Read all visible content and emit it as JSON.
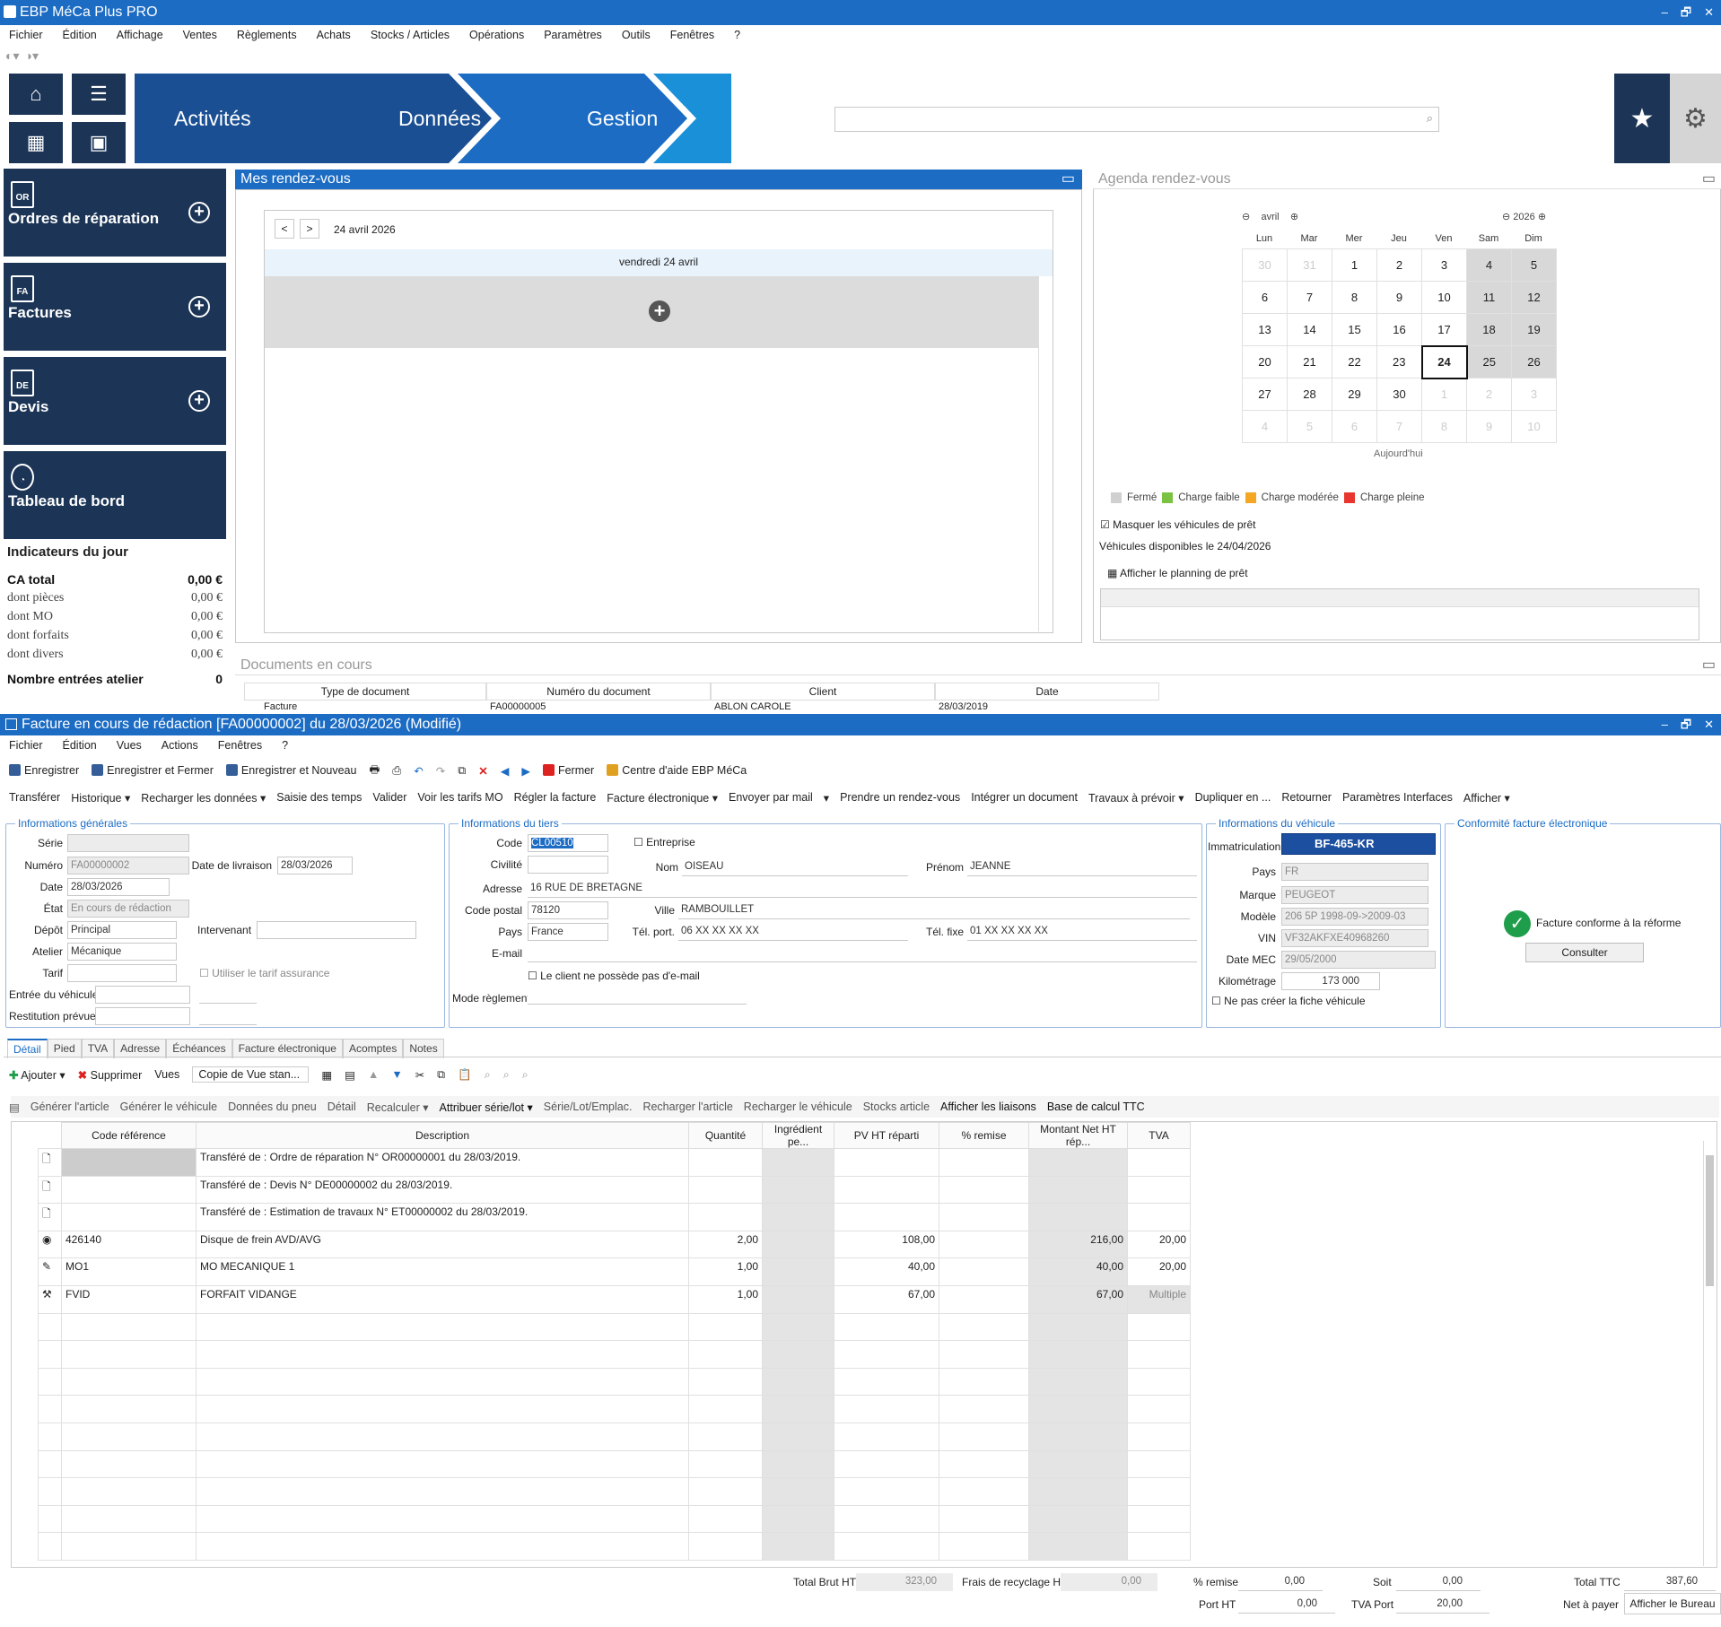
{
  "app": {
    "title": "EBP MéCa Plus PRO",
    "window_controls": [
      "–",
      "🗗",
      "✕"
    ]
  },
  "menu": [
    "Fichier",
    "Édition",
    "Affichage",
    "Ventes",
    "Règlements",
    "Achats",
    "Stocks / Articles",
    "Opérations",
    "Paramètres",
    "Outils",
    "Fenêtres",
    "?"
  ],
  "nav_tabs": [
    "Activités",
    "Données",
    "Gestion"
  ],
  "cards": [
    {
      "abbr": "OR",
      "label": "Ordres de réparation"
    },
    {
      "abbr": "FA",
      "label": "Factures"
    },
    {
      "abbr": "DE",
      "label": "Devis"
    },
    {
      "abbr": "",
      "label": "Tableau de bord"
    }
  ],
  "indicators": {
    "title": "Indicateurs du jour",
    "rows": [
      {
        "label": "CA total",
        "value": "0,00 €"
      },
      {
        "label": "dont pièces",
        "value": "0,00 €"
      },
      {
        "label": "dont MO",
        "value": "0,00 €"
      },
      {
        "label": "dont forfaits",
        "value": "0,00 €"
      },
      {
        "label": "dont divers",
        "value": "0,00 €"
      }
    ],
    "entries_label": "Nombre entrées atelier",
    "entries_value": "0"
  },
  "rdv": {
    "title": "Mes rendez-vous",
    "date": "24 avril 2026",
    "day_header": "vendredi 24 avril",
    "prev": "<",
    "next": ">"
  },
  "agenda": {
    "title": "Agenda rendez-vous",
    "month": "avril",
    "year": "2026",
    "days": [
      "Lun",
      "Mar",
      "Mer",
      "Jeu",
      "Ven",
      "Sam",
      "Dim"
    ],
    "weeks": [
      [
        "30",
        "31",
        "1",
        "2",
        "3",
        "4",
        "5"
      ],
      [
        "6",
        "7",
        "8",
        "9",
        "10",
        "11",
        "12"
      ],
      [
        "13",
        "14",
        "15",
        "16",
        "17",
        "18",
        "19"
      ],
      [
        "20",
        "21",
        "22",
        "23",
        "24",
        "25",
        "26"
      ],
      [
        "27",
        "28",
        "29",
        "30",
        "1",
        "2",
        "3"
      ],
      [
        "4",
        "5",
        "6",
        "7",
        "8",
        "9",
        "10"
      ]
    ],
    "today_label": "Aujourd'hui",
    "legend": [
      {
        "label": "Fermé",
        "color": "#d0d0d0"
      },
      {
        "label": "Charge faible",
        "color": "#7cc242"
      },
      {
        "label": "Charge modérée",
        "color": "#f5a623"
      },
      {
        "label": "Charge pleine",
        "color": "#e8352e"
      }
    ],
    "hide_loan": "Masquer les véhicules de prêt",
    "available": "Véhicules disponibles le 24/04/2026",
    "show_planning": "Afficher le planning de prêt"
  },
  "docs": {
    "title": "Documents en cours",
    "columns": [
      "Type de document",
      "Numéro du document",
      "Client",
      "Date"
    ],
    "row": [
      "Facture",
      "FA00000005",
      "ABLON CAROLE",
      "28/03/2019"
    ]
  },
  "doc": {
    "title": "Facture en cours de rédaction [FA00000002] du 28/03/2026 (Modifié)",
    "menu": [
      "Fichier",
      "Édition",
      "Vues",
      "Actions",
      "Fenêtres",
      "?"
    ],
    "toolbar1": [
      "Enregistrer",
      "Enregistrer et Fermer",
      "Enregistrer et Nouveau",
      "Fermer",
      "Centre d'aide EBP MéCa"
    ],
    "toolbar2": [
      "Transférer",
      "Historique ▾",
      "Recharger les données ▾",
      "Saisie des temps",
      "Valider",
      "Voir les tarifs MO",
      "Régler la facture",
      "Facture électronique ▾",
      "Envoyer par mail",
      "▾",
      "Prendre un rendez-vous",
      "Intégrer un document",
      "Travaux à prévoir ▾",
      "Dupliquer en ...",
      "Retourner",
      "Paramètres Interfaces",
      "Afficher ▾"
    ],
    "general": {
      "title": "Informations générales",
      "serie_l": "Série",
      "numero_l": "Numéro",
      "numero": "FA00000002",
      "date_l": "Date",
      "date": "28/03/2026",
      "livraison_l": "Date de livraison",
      "livraison": "28/03/2026",
      "etat_l": "État",
      "etat": "En cours de rédaction",
      "depot_l": "Dépôt",
      "depot": "Principal",
      "intervenant_l": "Intervenant",
      "atelier_l": "Atelier",
      "atelier": "Mécanique",
      "tarif_l": "Tarif",
      "tarif_ass": "Utiliser le tarif assurance",
      "entree_l": "Entrée du véhicule",
      "restitution_l": "Restitution prévue"
    },
    "tiers": {
      "title": "Informations du tiers",
      "code_l": "Code",
      "code": "CL00510",
      "entreprise": "Entreprise",
      "civilite_l": "Civilité",
      "nom_l": "Nom",
      "nom": "OISEAU",
      "prenom_l": "Prénom",
      "prenom": "JEANNE",
      "adresse_l": "Adresse",
      "adresse": "16 RUE DE BRETAGNE",
      "cp_l": "Code postal",
      "cp": "78120",
      "ville_l": "Ville",
      "ville": "RAMBOUILLET",
      "pays_l": "Pays",
      "pays": "France",
      "telport_l": "Tél. port.",
      "telport": "06 XX XX XX XX",
      "telfixe_l": "Tél. fixe",
      "telfixe": "01 XX XX XX XX",
      "email_l": "E-mail",
      "noemail": "Le client ne possède pas d'e-mail",
      "mode_l": "Mode règlement"
    },
    "vehicule": {
      "title": "Informations du véhicule",
      "immat_l": "Immatriculation",
      "immat": "BF-465-KR",
      "pays_l": "Pays",
      "pays": "FR",
      "marque_l": "Marque",
      "marque": "PEUGEOT",
      "modele_l": "Modèle",
      "modele": "206 5P 1998-09->2009-03",
      "vin_l": "VIN",
      "vin": "VF32AKFXE40968260",
      "mec_l": "Date MEC",
      "mec": "29/05/2000",
      "km_l": "Kilométrage",
      "km": "173 000",
      "nocreate": "Ne pas créer la fiche véhicule"
    },
    "conformite": {
      "title": "Conformité facture électronique",
      "status": "Facture conforme à la réforme",
      "button": "Consulter"
    },
    "tabs": [
      "Détail",
      "Pied",
      "TVA",
      "Adresse",
      "Échéances",
      "Facture électronique",
      "Acomptes",
      "Notes"
    ],
    "lines_toolbar": [
      "Ajouter ▾",
      "Supprimer",
      "Vues",
      "Copie de Vue stan..."
    ],
    "lines_toolbar2": [
      "Générer l'article",
      "Générer le véhicule",
      "Données du pneu",
      "Détail",
      "Recalculer ▾",
      "Attribuer série/lot ▾",
      "Série/Lot/Emplac.",
      "Recharger l'article",
      "Recharger le véhicule",
      "Stocks article",
      "Afficher les liaisons",
      "Base de calcul TTC"
    ],
    "columns": [
      "Code référence",
      "Description",
      "Quantité",
      "Ingrédient pe...",
      "PV HT réparti",
      "% remise",
      "Montant Net HT rép...",
      "TVA"
    ],
    "rows": [
      [
        "",
        "Transféré de : Ordre de réparation N° OR00000001 du 28/03/2019.",
        "",
        "",
        "",
        "",
        "",
        ""
      ],
      [
        "",
        "Transféré de : Devis N° DE00000002 du 28/03/2019.",
        "",
        "",
        "",
        "",
        "",
        ""
      ],
      [
        "",
        "Transféré de : Estimation de travaux N° ET00000002 du 28/03/2019.",
        "",
        "",
        "",
        "",
        "",
        ""
      ],
      [
        "426140",
        "Disque de frein AVD/AVG",
        "2,00",
        "",
        "108,00",
        "",
        "216,00",
        "20,00"
      ],
      [
        "MO1",
        "MO MECANIQUE 1",
        "1,00",
        "",
        "40,00",
        "",
        "40,00",
        "20,00"
      ],
      [
        "FVID",
        "FORFAIT VIDANGE",
        "1,00",
        "",
        "67,00",
        "",
        "67,00",
        "Multiple"
      ]
    ],
    "totals": {
      "brut_l": "Total Brut HT",
      "brut": "323,00",
      "frais_l": "Frais de recyclage HT",
      "frais": "0,00",
      "remise_l": "% remise",
      "remise": "0,00",
      "soit_l": "Soit",
      "soit": "0,00",
      "ttc_l": "Total TTC",
      "ttc": "387,60",
      "port_l": "Port HT",
      "port": "0,00",
      "tvaport_l": "TVA Port",
      "tvaport": "20,00",
      "net_l": "Net à payer",
      "bureau": "Afficher le Bureau"
    }
  }
}
